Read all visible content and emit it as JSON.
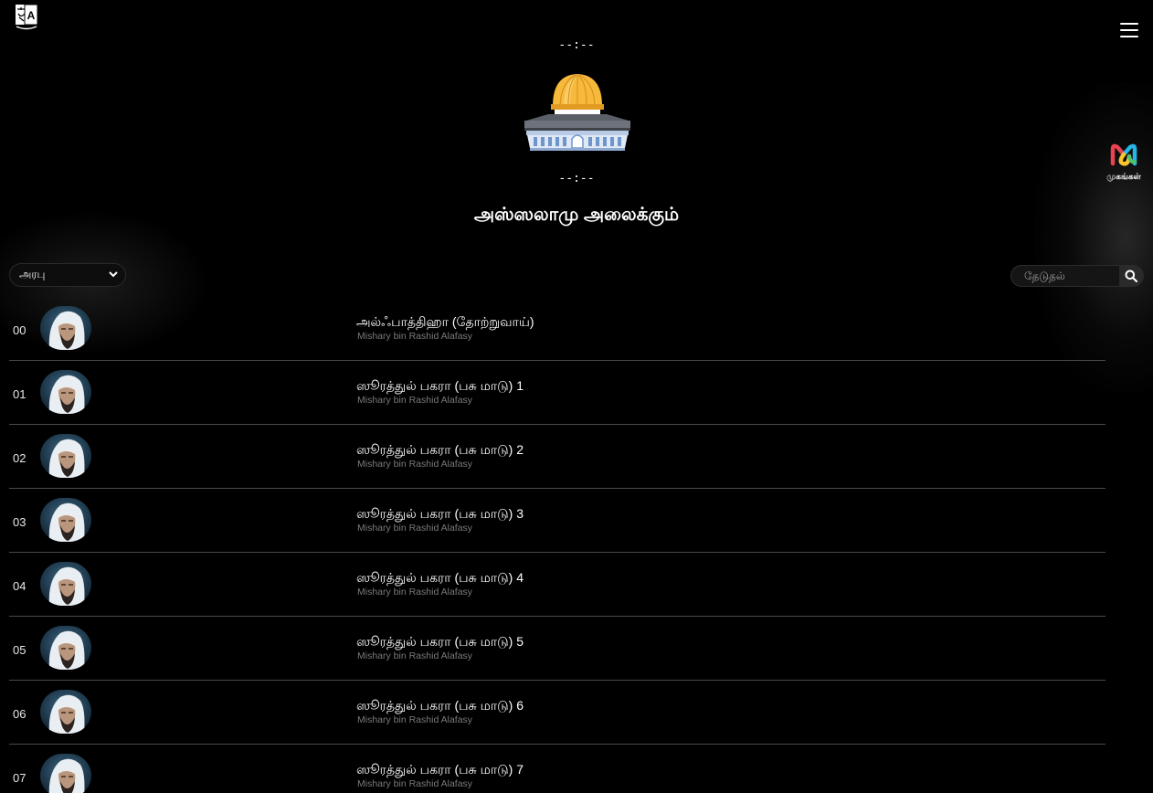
{
  "header": {
    "time_top": "--:--",
    "time_bottom": "--:--",
    "greeting": "அஸ்ஸலாமு அலைக்கும்",
    "language_icon": "translate-icon",
    "menu_icon": "hamburger-menu-icon",
    "mosque_icon": "dome-of-the-rock-icon"
  },
  "side_app": {
    "label": "முகங்கள்",
    "icon": "m-logo-icon"
  },
  "controls": {
    "language_selected": "அரபு",
    "search_placeholder": "தேடுதல்",
    "search_icon": "search-icon"
  },
  "tracks": [
    {
      "number": "00",
      "title": "அல்ஃபாத்திஹா (தோற்றுவாய்)",
      "artist": "Mishary bin Rashid Alafasy"
    },
    {
      "number": "01",
      "title": "ஸூரத்துல் பகரா (பசு மாடு) 1",
      "artist": "Mishary bin Rashid Alafasy"
    },
    {
      "number": "02",
      "title": "ஸூரத்துல் பகரா (பசு மாடு) 2",
      "artist": "Mishary bin Rashid Alafasy"
    },
    {
      "number": "03",
      "title": "ஸூரத்துல் பகரா (பசு மாடு) 3",
      "artist": "Mishary bin Rashid Alafasy"
    },
    {
      "number": "04",
      "title": "ஸூரத்துல் பகரா (பசு மாடு) 4",
      "artist": "Mishary bin Rashid Alafasy"
    },
    {
      "number": "05",
      "title": "ஸூரத்துல் பகரா (பசு மாடு) 5",
      "artist": "Mishary bin Rashid Alafasy"
    },
    {
      "number": "06",
      "title": "ஸூரத்துல் பகரா (பசு மாடு) 6",
      "artist": "Mishary bin Rashid Alafasy"
    },
    {
      "number": "07",
      "title": "ஸூரத்துல் பகரா (பசு மாடு) 7",
      "artist": "Mishary bin Rashid Alafasy"
    }
  ],
  "colors": {
    "background": "#000000",
    "text": "#ffffff",
    "artist_text": "#7a7a7a",
    "divider": "#4a4a4a",
    "dome": "#f5b83d"
  }
}
